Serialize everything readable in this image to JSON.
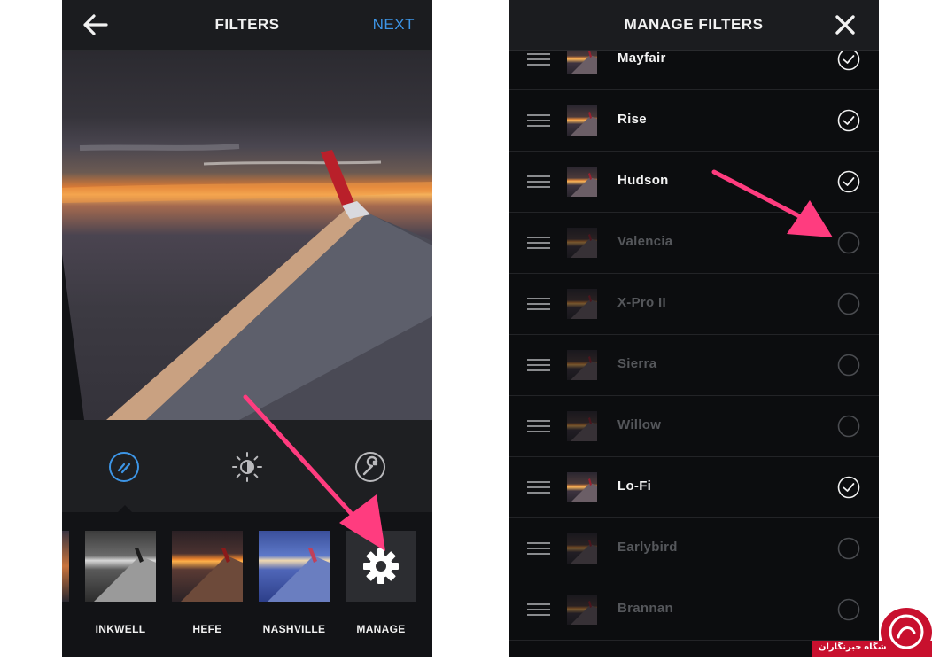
{
  "left_screen": {
    "header": {
      "title": "FILTERS",
      "next_label": "NEXT"
    },
    "filters": [
      {
        "label": "INKWELL"
      },
      {
        "label": "HEFE"
      },
      {
        "label": "NASHVILLE"
      },
      {
        "label": "MANAGE"
      }
    ]
  },
  "right_screen": {
    "header": {
      "title": "MANAGE FILTERS"
    },
    "items": [
      {
        "name": "Mayfair",
        "enabled": true
      },
      {
        "name": "Rise",
        "enabled": true
      },
      {
        "name": "Hudson",
        "enabled": true
      },
      {
        "name": "Valencia",
        "enabled": false
      },
      {
        "name": "X-Pro II",
        "enabled": false
      },
      {
        "name": "Sierra",
        "enabled": false
      },
      {
        "name": "Willow",
        "enabled": false
      },
      {
        "name": "Lo-Fi",
        "enabled": true
      },
      {
        "name": "Earlybird",
        "enabled": false
      },
      {
        "name": "Brannan",
        "enabled": false
      }
    ]
  },
  "watermark": {
    "text": "باشگاه خبرنگاران"
  },
  "colors": {
    "accent_blue": "#3d95e6",
    "annotation_pink": "#ff3c7f",
    "watermark_red": "#c8102e"
  }
}
